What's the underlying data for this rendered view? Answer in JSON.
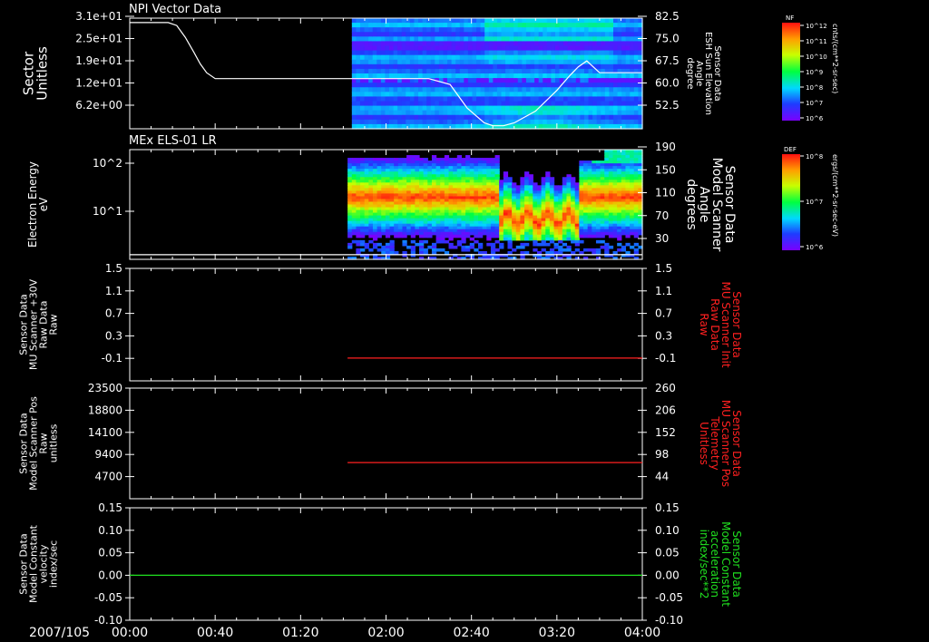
{
  "time_axis": {
    "date_label": "2007/105",
    "ticks": [
      "00:00",
      "00:40",
      "01:20",
      "02:00",
      "02:40",
      "03:20",
      "04:00"
    ],
    "range_minutes": [
      0,
      240
    ]
  },
  "chart_data": [
    {
      "id": "panel1",
      "type": "heatmap",
      "title": "NPI Vector Data",
      "ylabel_left": [
        "Sector",
        "Unitless"
      ],
      "yticks_left": [
        "3.1e+01",
        "2.5e+01",
        "1.9e+01",
        "1.2e+01",
        "6.2e+00"
      ],
      "ylabel_right": [
        "Sensor Data",
        "ESH Sun Elevation",
        "Angle",
        "degree"
      ],
      "yticks_right": [
        "82.5",
        "75.0",
        "67.5",
        "60.0",
        "52.5"
      ],
      "ylim_right": [
        45,
        82.5
      ],
      "data_start_minute": 104,
      "line_series": {
        "name": "ESH Sun Elevation Angle",
        "color": "#ffffff",
        "x": [
          0,
          18,
          22,
          26,
          30,
          33,
          36,
          40,
          60,
          100,
          104,
          120,
          140,
          150,
          158,
          166,
          170,
          175,
          180,
          190,
          200,
          206,
          210,
          214,
          220,
          240
        ],
        "y": [
          81,
          81,
          80,
          76,
          71,
          67,
          64,
          62,
          62,
          62,
          62,
          62,
          62,
          60,
          52,
          47,
          46,
          46,
          47,
          51,
          58,
          63,
          66,
          68,
          64,
          64
        ]
      },
      "colorbar": {
        "label": "NF",
        "ticks": [
          "10^12",
          "10^11",
          "10^10",
          "10^9",
          "10^8",
          "10^7",
          "10^6"
        ],
        "units": "cnts/(cm**2-sr-sec)"
      }
    },
    {
      "id": "panel2",
      "type": "heatmap",
      "title": "MEx ELS-01 LR",
      "ylabel_left": [
        "Electron Energy",
        "eV"
      ],
      "yticks_left": [
        "10^2",
        "10^1"
      ],
      "ylabel_right": [
        "Sensor Data",
        "Model Scanner",
        "Angle",
        "degrees"
      ],
      "yticks_right": [
        "190",
        "150",
        "110",
        "70",
        "30"
      ],
      "ylim_right": [
        0,
        190
      ],
      "data_start_minute": 102,
      "line_series": {
        "name": "Model Scanner Angle",
        "color": "#ffffff",
        "x": [
          0,
          240
        ],
        "y": [
          8,
          8
        ]
      },
      "colorbar": {
        "label": "DEF",
        "ticks": [
          "10^8",
          "10^7",
          "10^6"
        ],
        "units": "ergs/(cm**2-sr-sec-eV)"
      }
    },
    {
      "id": "panel3",
      "type": "line",
      "ylabel_left": [
        "Sensor Data",
        "MU Scanner +30V",
        "Raw Data",
        "Raw"
      ],
      "yticks_left": [
        "1.5",
        "1.1",
        "0.7",
        "0.3",
        "-0.1"
      ],
      "ylim": [
        -0.38,
        1.5
      ],
      "ylabel_right": [
        "Sensor Data",
        "MU Scanner Init",
        "Raw Data",
        "Raw"
      ],
      "yticks_right": [
        "1.5",
        "1.1",
        "0.7",
        "0.3",
        "-0.1"
      ],
      "series": [
        {
          "name": "MU Scanner Init",
          "color": "#ff2020",
          "x": [
            102,
            240
          ],
          "y": [
            0,
            0
          ]
        }
      ]
    },
    {
      "id": "panel4",
      "type": "line",
      "ylabel_left": [
        "Sensor Data",
        "Model Scanner Pos",
        "Raw",
        "unitless"
      ],
      "yticks_left": [
        "23500",
        "18800",
        "14100",
        "9400",
        "4700"
      ],
      "ylim_right": [
        0,
        260
      ],
      "ylabel_right": [
        "Sensor Data",
        "MU Scanner Pos",
        "Telemetry",
        "Unitless"
      ],
      "yticks_right": [
        "260",
        "206",
        "152",
        "98",
        "44"
      ],
      "series": [
        {
          "name": "MU Scanner Pos",
          "color": "#ff2020",
          "x": [
            102,
            240
          ],
          "y": [
            85,
            85
          ]
        }
      ]
    },
    {
      "id": "panel5",
      "type": "line",
      "ylabel_left": [
        "Sensor Data",
        "Model Constant",
        "velocity",
        "index/sec"
      ],
      "yticks_left": [
        "0.15",
        "0.10",
        "0.05",
        "0.00",
        "-0.05",
        "-0.10"
      ],
      "ylim": [
        -0.1,
        0.15
      ],
      "ylabel_right": [
        "Sensor Data",
        "Model Constant",
        "acceleration",
        "index/sec**2"
      ],
      "yticks_right": [
        "0.15",
        "0.10",
        "0.05",
        "0.00",
        "-0.05",
        "-0.10"
      ],
      "series": [
        {
          "name": "Model Constant acceleration",
          "color": "#20e020",
          "x": [
            0,
            240
          ],
          "y": [
            0,
            0
          ]
        }
      ]
    }
  ],
  "colors": {
    "background": "#000000",
    "axis": "#ffffff",
    "red_label": "#ff2020",
    "green_label": "#20e020"
  }
}
